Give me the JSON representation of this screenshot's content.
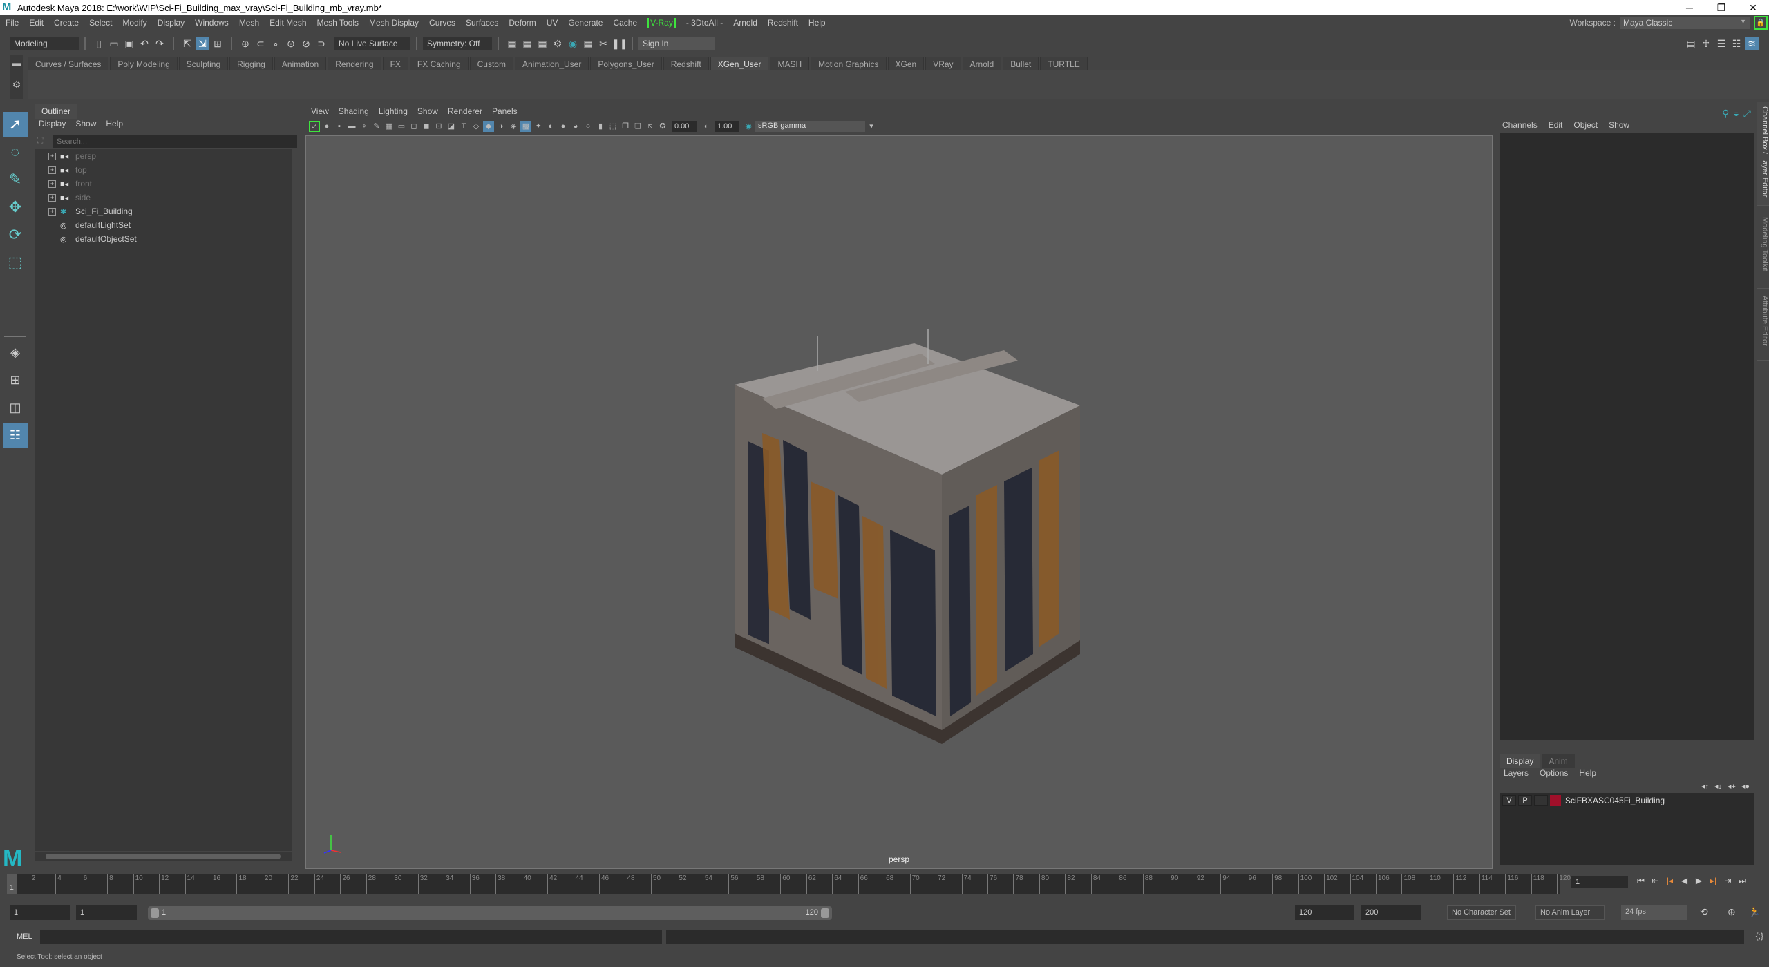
{
  "window": {
    "title": "Autodesk Maya 2018: E:\\work\\WIP\\Sci-Fi_Building_max_vray\\Sci-Fi_Building_mb_vray.mb*",
    "controls": {
      "minimize": "─",
      "restore": "❐",
      "close": "✕"
    }
  },
  "menubar": {
    "items": [
      "File",
      "Edit",
      "Create",
      "Select",
      "Modify",
      "Display",
      "Windows",
      "Mesh",
      "Edit Mesh",
      "Mesh Tools",
      "Mesh Display",
      "Curves",
      "Surfaces",
      "Deform",
      "UV",
      "Generate",
      "Cache",
      "V-Ray",
      "- 3DtoAll -",
      "Arnold",
      "Redshift",
      "Help"
    ],
    "workspace_label": "Workspace :",
    "workspace_value": "Maya Classic"
  },
  "toolbar": {
    "mode": "Modeling",
    "live_surface": "No Live Surface",
    "symmetry": "Symmetry: Off",
    "sign_in": "Sign In"
  },
  "shelf": {
    "tabs": [
      "Curves / Surfaces",
      "Poly Modeling",
      "Sculpting",
      "Rigging",
      "Animation",
      "Rendering",
      "FX",
      "FX Caching",
      "Custom",
      "Animation_User",
      "Polygons_User",
      "Redshift",
      "XGen_User",
      "MASH",
      "Motion Graphics",
      "XGen",
      "VRay",
      "Arnold",
      "Bullet",
      "TURTLE"
    ],
    "active": "XGen_User"
  },
  "outliner": {
    "title": "Outliner",
    "menu": [
      "Display",
      "Show",
      "Help"
    ],
    "search_placeholder": "Search...",
    "items": [
      {
        "label": "persp",
        "icon": "camera-icon",
        "expandable": true,
        "dim": true
      },
      {
        "label": "top",
        "icon": "camera-icon",
        "expandable": true,
        "dim": true
      },
      {
        "label": "front",
        "icon": "camera-icon",
        "expandable": true,
        "dim": true
      },
      {
        "label": "side",
        "icon": "camera-icon",
        "expandable": true,
        "dim": true
      },
      {
        "label": "Sci_Fi_Building",
        "icon": "group-icon",
        "expandable": true,
        "dim": false
      },
      {
        "label": "defaultLightSet",
        "icon": "set-icon",
        "expandable": false,
        "dim": false
      },
      {
        "label": "defaultObjectSet",
        "icon": "set-icon",
        "expandable": false,
        "dim": false
      }
    ]
  },
  "viewport": {
    "menu": [
      "View",
      "Shading",
      "Lighting",
      "Show",
      "Renderer",
      "Panels"
    ],
    "exposure": "0.00",
    "gamma": "1.00",
    "color_space": "sRGB gamma",
    "camera_label": "persp"
  },
  "channel_box": {
    "menu": [
      "Channels",
      "Edit",
      "Object",
      "Show"
    ]
  },
  "layer_editor": {
    "tabs": [
      "Display",
      "Anim"
    ],
    "active_tab": "Display",
    "menu": [
      "Layers",
      "Options",
      "Help"
    ],
    "layers": [
      {
        "v": "V",
        "p": "P",
        "name": "SciFBXASC045Fi_Building",
        "color": "#a0102a"
      }
    ]
  },
  "side_tabs": [
    "Channel Box / Layer Editor",
    "Modeling Toolkit",
    "Attribute Editor"
  ],
  "timeline": {
    "start": 1,
    "end": 120,
    "current": "1",
    "tick_labels": [
      2,
      4,
      6,
      8,
      10,
      12,
      14,
      16,
      18,
      20,
      22,
      24,
      26,
      28,
      30,
      32,
      34,
      36,
      38,
      40,
      42,
      44,
      46,
      48,
      50,
      52,
      54,
      56,
      58,
      60,
      62,
      64,
      66,
      68,
      70,
      72,
      74,
      76,
      78,
      80,
      82,
      84,
      86,
      88,
      90,
      92,
      94,
      96,
      98,
      100,
      102,
      104,
      106,
      108,
      110,
      112,
      114,
      116,
      118,
      120
    ],
    "current_frame_field": "1"
  },
  "range": {
    "start_field": "1",
    "playback_start": "1",
    "slider_start": "1",
    "slider_end": "120",
    "playback_end": "120",
    "end_field": "200",
    "character_set": "No Character Set",
    "anim_layer": "No Anim Layer",
    "fps": "24 fps"
  },
  "command_line": {
    "label": "MEL"
  },
  "status": {
    "text": "Select Tool: select an object"
  }
}
